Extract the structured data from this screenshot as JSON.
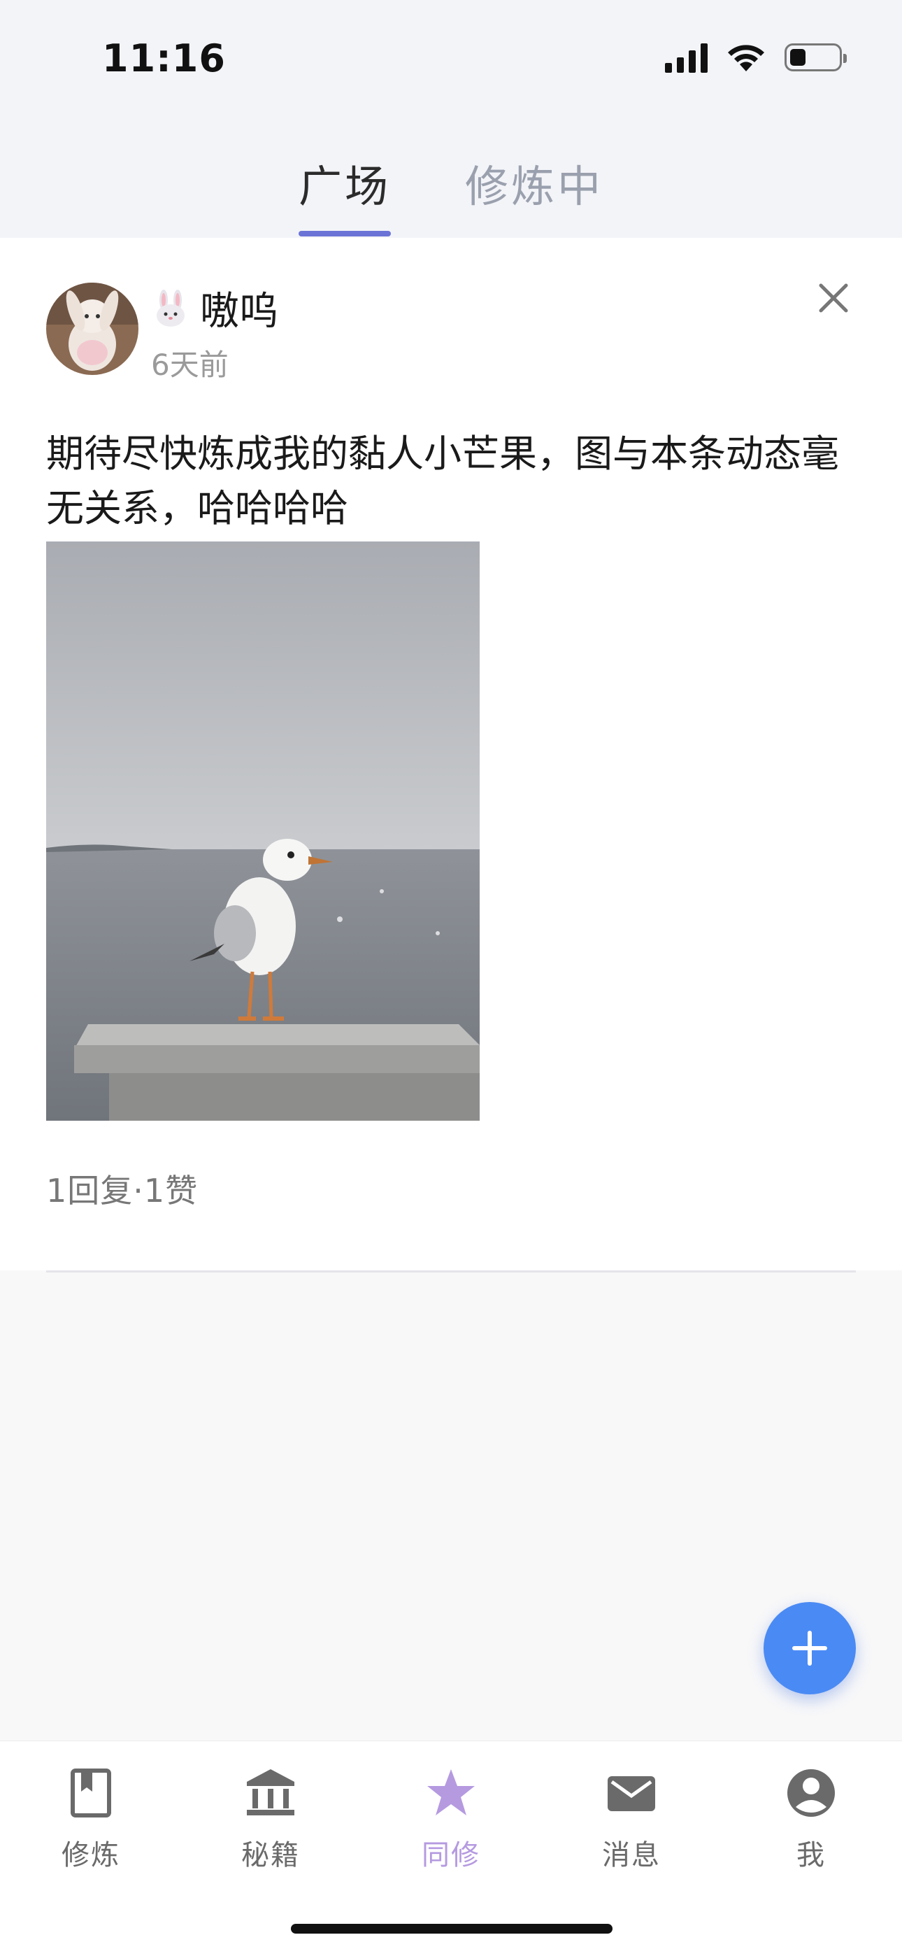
{
  "status_bar": {
    "time": "11:16"
  },
  "header": {
    "tabs": [
      {
        "label": "广场",
        "active": true
      },
      {
        "label": "修炼中",
        "active": false
      }
    ],
    "accent_color": "#6b74d6"
  },
  "post": {
    "author": "嗷呜",
    "author_emoji_icon": "rabbit-face-icon",
    "time_ago": "6天前",
    "text": "期待尽快炼成我的黏人小芒果，图与本条动态毫无关系，哈哈哈哈",
    "image_description_icon": "seagull-photo",
    "stats": "1回复·1赞"
  },
  "fab": {
    "icon": "plus-icon",
    "color": "#4a8af4"
  },
  "bottom_nav": {
    "items": [
      {
        "label": "修炼",
        "icon": "book-icon",
        "active": false
      },
      {
        "label": "秘籍",
        "icon": "library-icon",
        "active": false
      },
      {
        "label": "同修",
        "icon": "star-icon",
        "active": true
      },
      {
        "label": "消息",
        "icon": "mail-icon",
        "active": false
      },
      {
        "label": "我",
        "icon": "account-icon",
        "active": false
      }
    ],
    "active_color": "#b59ae0"
  }
}
